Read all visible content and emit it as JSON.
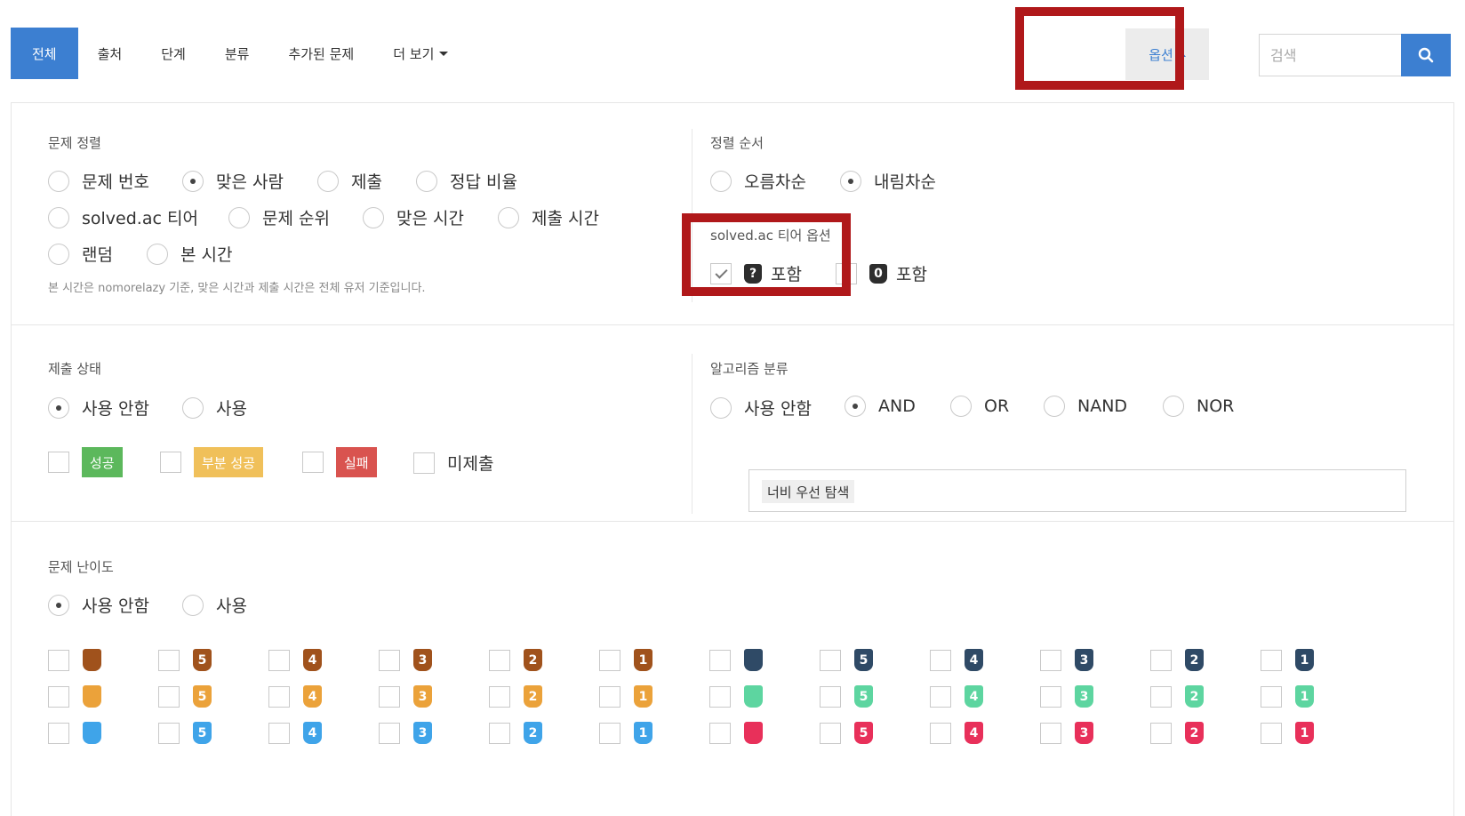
{
  "nav": {
    "tabs": [
      {
        "label": "전체",
        "active": true
      },
      {
        "label": "출처",
        "active": false
      },
      {
        "label": "단계",
        "active": false
      },
      {
        "label": "분류",
        "active": false
      },
      {
        "label": "추가된 문제",
        "active": false
      },
      {
        "label": "더 보기",
        "active": false,
        "dropdown": true
      }
    ],
    "option_label": "옵션",
    "search_placeholder": "검색"
  },
  "sort": {
    "title": "문제 정렬",
    "options": [
      "문제 번호",
      "맞은 사람",
      "제출",
      "정답 비율",
      "solved.ac 티어",
      "문제 순위",
      "맞은 시간",
      "제출 시간",
      "랜덤",
      "본 시간"
    ],
    "selected": "맞은 사람",
    "note": "본 시간은 nomorelazy 기준, 맞은 시간과 제출 시간은 전체 유저 기준입니다."
  },
  "order": {
    "title": "정렬 순서",
    "options": [
      "오름차순",
      "내림차순"
    ],
    "selected": "내림차순",
    "tier_title": "solved.ac 티어 옵션",
    "tier_opts": [
      {
        "icon": "?",
        "label": "포함",
        "checked": true
      },
      {
        "icon": "0",
        "label": "포함",
        "checked": false
      }
    ]
  },
  "submit": {
    "title": "제출 상태",
    "options": [
      "사용 안함",
      "사용"
    ],
    "selected": "사용 안함",
    "statuses": [
      {
        "label": "성공",
        "color": "#5cb85c"
      },
      {
        "label": "부분 성공",
        "color": "#f0c05a"
      },
      {
        "label": "실패",
        "color": "#d9534f"
      },
      {
        "label": "미제출",
        "color": ""
      }
    ]
  },
  "algo": {
    "title": "알고리즘 분류",
    "options": [
      "사용 안함",
      "AND",
      "OR",
      "NAND",
      "NOR"
    ],
    "selected": "AND",
    "tag": "너비 우선 탐색"
  },
  "level": {
    "title": "문제 난이도",
    "options": [
      "사용 안함",
      "사용"
    ],
    "selected": "사용 안함",
    "rows": [
      {
        "colors": [
          "#a0521c",
          "#2f4a66"
        ],
        "labels": [
          "",
          "5",
          "4",
          "3",
          "2",
          "1",
          "",
          "5",
          "4",
          "3",
          "2",
          "1"
        ]
      },
      {
        "colors": [
          "#eba23a",
          "#5dd5a0"
        ],
        "labels": [
          "",
          "5",
          "4",
          "3",
          "2",
          "1",
          "",
          "5",
          "4",
          "3",
          "2",
          "1"
        ]
      },
      {
        "colors": [
          "#3fa4e9",
          "#e8305a"
        ],
        "labels": [
          "",
          "5",
          "4",
          "3",
          "2",
          "1",
          "",
          "5",
          "4",
          "3",
          "2",
          "1"
        ]
      }
    ]
  }
}
